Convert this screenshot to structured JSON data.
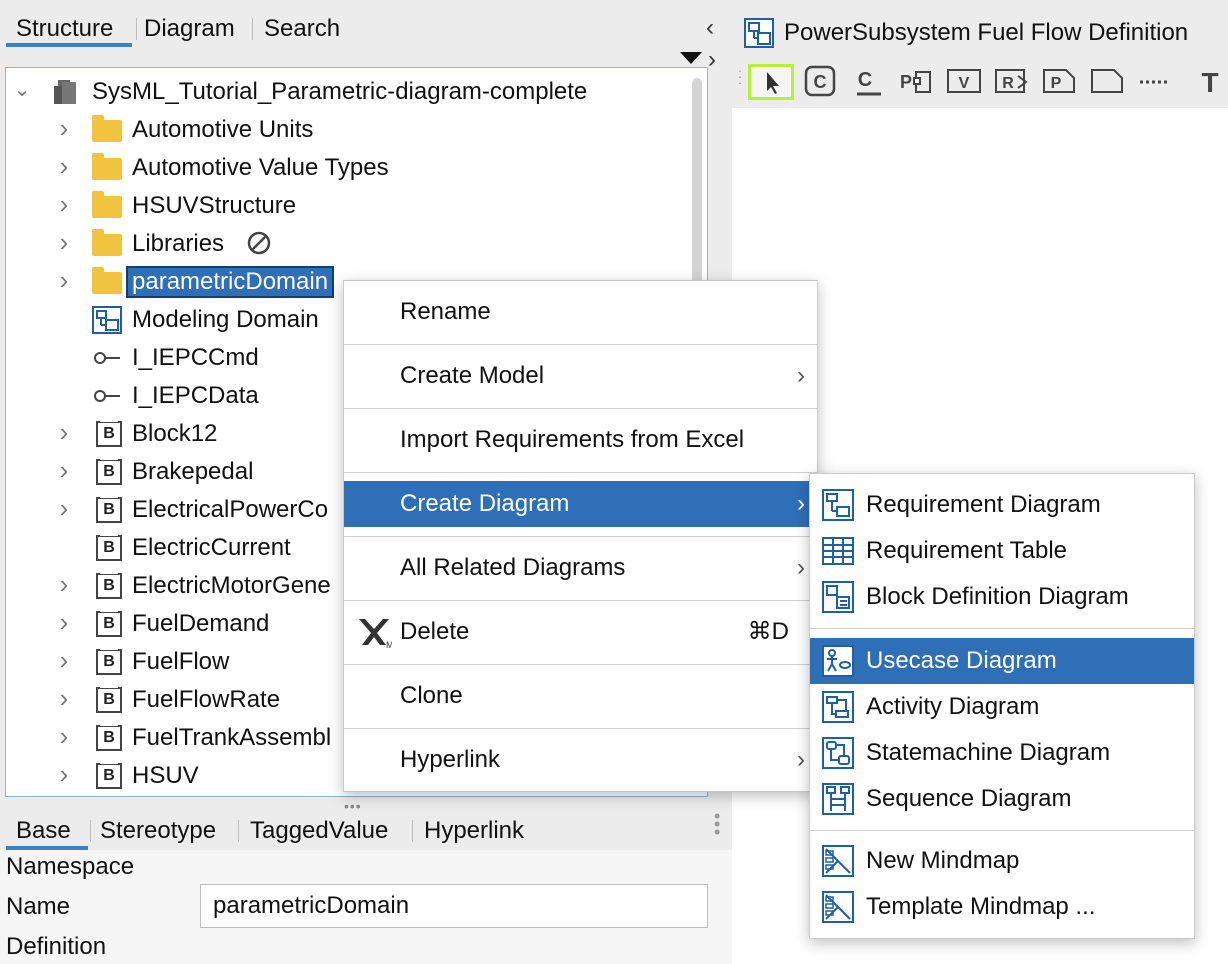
{
  "left_panel": {
    "tabs": [
      "Structure",
      "Diagram",
      "Search"
    ],
    "tree": {
      "root": "SysML_Tutorial_Parametric-diagram-complete",
      "items": [
        {
          "label": "Automotive Units",
          "type": "folder",
          "expandable": true
        },
        {
          "label": "Automotive Value Types",
          "type": "folder",
          "expandable": true
        },
        {
          "label": "HSUVStructure",
          "type": "folder",
          "expandable": true
        },
        {
          "label": "Libraries",
          "type": "folder",
          "expandable": true
        },
        {
          "label": "parametricDomain",
          "type": "folder",
          "expandable": true,
          "selected": true
        },
        {
          "label": "Modeling Domain",
          "type": "diagram",
          "expandable": false
        },
        {
          "label": "I_IEPCCmd",
          "type": "interface",
          "expandable": false
        },
        {
          "label": "I_IEPCData",
          "type": "interface",
          "expandable": false
        },
        {
          "label": "Block12",
          "type": "block",
          "expandable": true
        },
        {
          "label": "Brakepedal",
          "type": "block",
          "expandable": true
        },
        {
          "label": "ElectricalPowerCo",
          "type": "block",
          "expandable": true
        },
        {
          "label": "ElectricCurrent",
          "type": "block",
          "expandable": false
        },
        {
          "label": "ElectricMotorGene",
          "type": "block",
          "expandable": true
        },
        {
          "label": "FuelDemand",
          "type": "block",
          "expandable": true
        },
        {
          "label": "FuelFlow",
          "type": "block",
          "expandable": true
        },
        {
          "label": "FuelFlowRate",
          "type": "block",
          "expandable": true
        },
        {
          "label": "FuelTrankAssembl",
          "type": "block",
          "expandable": true
        },
        {
          "label": "HSUV",
          "type": "block",
          "expandable": true
        }
      ]
    },
    "property_tabs": [
      "Base",
      "Stereotype",
      "TaggedValue",
      "Hyperlink"
    ],
    "properties": {
      "namespace_label": "Namespace",
      "name_label": "Name",
      "name_value": "parametricDomain",
      "definition_label": "Definition"
    }
  },
  "right_panel": {
    "title": "PowerSubsystem Fuel Flow Definition",
    "toolbar": [
      "select-icon",
      "class-icon",
      "c-underline-icon",
      "port-icon",
      "value-icon",
      "reference-icon",
      "part-icon",
      "note-icon",
      "dash-line-icon",
      "text-icon"
    ]
  },
  "context_menu": {
    "items": [
      {
        "label": "Rename",
        "submenu": false
      },
      {
        "label": "Create Model",
        "submenu": true
      },
      {
        "label": "Import Requirements from Excel",
        "submenu": false
      },
      {
        "label": "Create Diagram",
        "submenu": true,
        "highlighted": true
      },
      {
        "label": "All Related Diagrams",
        "submenu": true
      },
      {
        "label": "Delete",
        "submenu": false,
        "shortcut": "⌘D"
      },
      {
        "label": "Clone",
        "submenu": false
      },
      {
        "label": "Hyperlink",
        "submenu": true
      }
    ]
  },
  "submenu": {
    "groups": [
      [
        "Requirement Diagram",
        "Requirement Table",
        "Block Definition Diagram"
      ],
      [
        "Usecase Diagram",
        "Activity Diagram",
        "Statemachine Diagram",
        "Sequence Diagram"
      ],
      [
        "New Mindmap",
        "Template Mindmap ..."
      ]
    ],
    "highlighted": "Usecase Diagram"
  },
  "colors": {
    "selection": "#2e6fb8",
    "folder": "#f2c33f",
    "tab_accent": "#3b82c4",
    "toolbar_selected": "#b6f03a"
  }
}
